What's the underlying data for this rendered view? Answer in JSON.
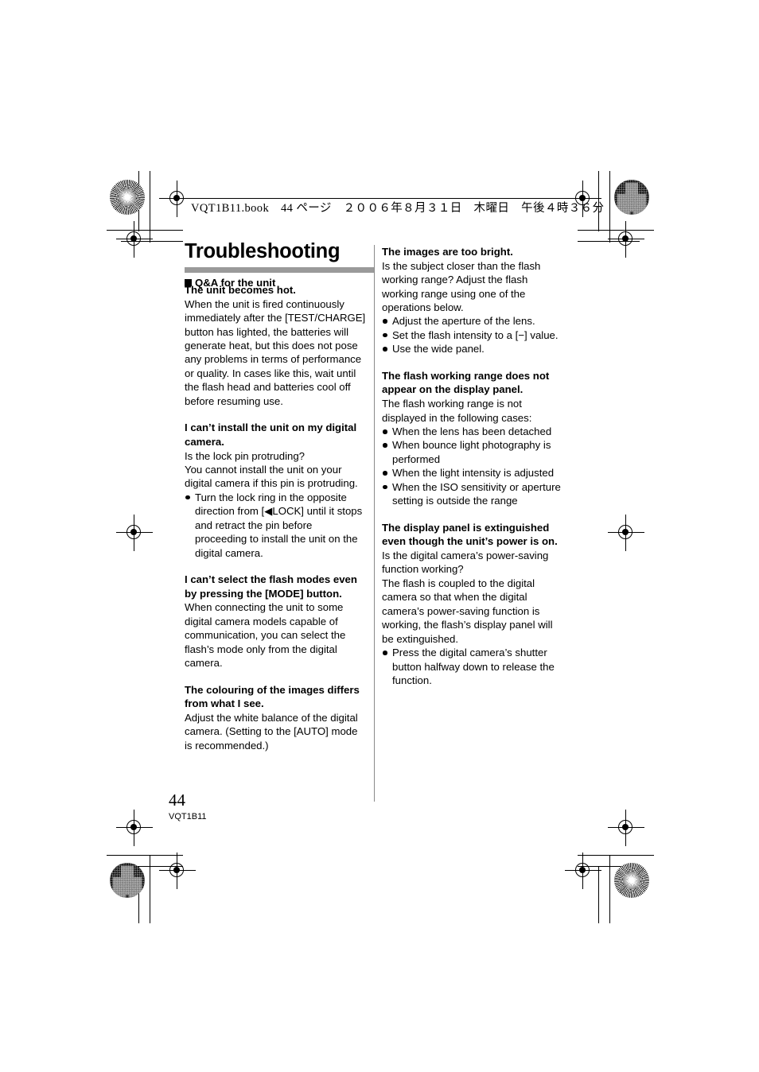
{
  "header_slug": {
    "text": "VQT1B11.book　44 ページ　２００６年８月３１日　木曜日　午後４時３６分"
  },
  "page_title": "Troubleshooting",
  "qa_section_heading": "Q&A for the unit",
  "left_column": {
    "blocks": [
      {
        "heading": "The unit becomes hot.",
        "paragraphs": [
          "When the unit is fired continuously immediately after the [TEST/CHARGE] button has lighted, the batteries will generate heat, but this does not pose any problems in terms of performance or quality. In cases like this, wait until the flash head and batteries cool off before resuming use."
        ],
        "bullets": []
      },
      {
        "heading": "I can’t install the unit on my digital camera.",
        "paragraphs": [
          "Is the lock pin protruding?",
          "You cannot install the unit on your digital camera if this pin is protruding."
        ],
        "bullets": [
          "Turn the lock ring in the opposite direction from [◀LOCK] until it stops and retract the pin before proceeding to install the unit on the digital camera."
        ]
      },
      {
        "heading": "I can’t select the flash modes even by pressing the [MODE] button.",
        "paragraphs": [
          "When connecting the unit to some digital camera models capable of communication, you can select the flash’s mode only from the digital camera."
        ],
        "bullets": []
      },
      {
        "heading": "The colouring of the images differs from what I see.",
        "paragraphs": [
          "Adjust the white balance of the digital camera. (Setting to the [AUTO] mode is recommended.)"
        ],
        "bullets": []
      }
    ]
  },
  "right_column": {
    "blocks": [
      {
        "heading": "The images are too bright.",
        "paragraphs": [
          "Is the subject closer than the flash working range? Adjust the flash working range using one of the operations below."
        ],
        "bullets": [
          "Adjust the aperture of the lens.",
          "Set the flash intensity to a [−] value.",
          "Use the wide panel."
        ]
      },
      {
        "heading": "The flash working range does not appear on the display panel.",
        "paragraphs": [
          "The flash working range is not displayed in the following cases:"
        ],
        "bullets": [
          "When the lens has been detached",
          "When bounce light photography is performed",
          "When the light intensity is adjusted",
          "When the ISO sensitivity or aperture setting is outside the range"
        ]
      },
      {
        "heading": "The display panel is extinguished even though the unit’s power is on.",
        "paragraphs": [
          "Is the digital camera’s power-saving function working?",
          "The flash is coupled to the digital camera so that when the digital camera’s power-saving function is working, the flash’s display panel will be extinguished."
        ],
        "bullets": [
          "Press the digital camera’s shutter button halfway down to release the function."
        ]
      }
    ]
  },
  "footer": {
    "page_number": "44",
    "document_code": "VQT1B11"
  },
  "colors": {
    "title_rule": "#9a9a9a",
    "text": "#000000",
    "divider": "#8a8a8a"
  }
}
